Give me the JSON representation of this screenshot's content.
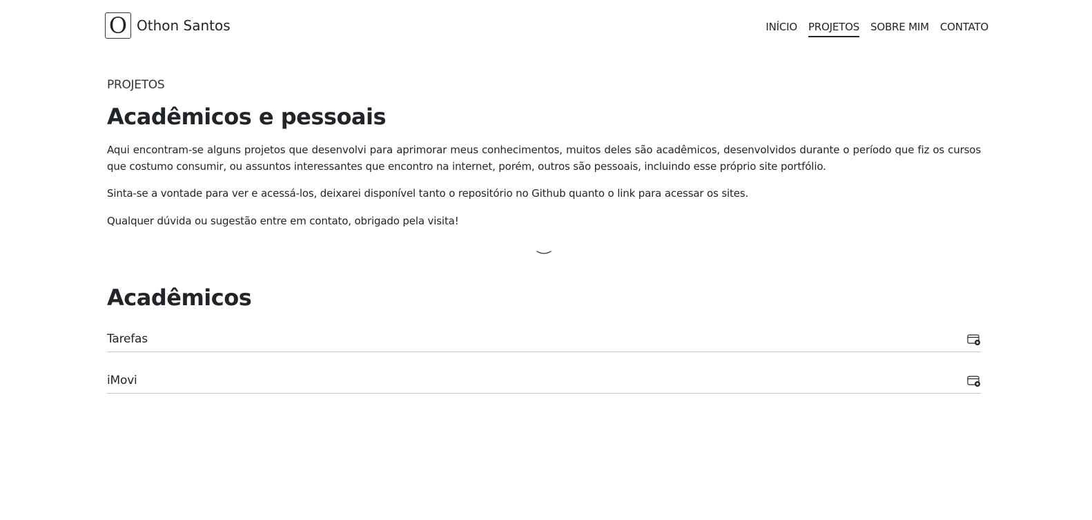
{
  "header": {
    "logo_letter": "O",
    "site_name": "Othon Santos",
    "nav": [
      {
        "label": "INÍCIO",
        "active": false
      },
      {
        "label": "PROJETOS",
        "active": true
      },
      {
        "label": "SOBRE MIM",
        "active": false
      },
      {
        "label": "CONTATO",
        "active": false
      }
    ]
  },
  "intro": {
    "eyebrow": "PROJETOS",
    "title": "Acadêmicos e pessoais",
    "paragraphs": [
      "Aqui encontram-se alguns projetos que desenvolvi para aprimorar meus conhecimentos, muitos deles são acadêmicos, desenvolvidos durante o período que fiz os cursos que costumo consumir, ou assuntos interessantes que encontro na internet, porém, outros são pessoais, incluindo esse próprio site portfólio.",
      "Sinta-se a vontade para ver e acessá-los, deixarei disponível tanto o repositório no Github quanto o link para acessar os sites.",
      "Qualquer dúvida ou sugestão entre em contato, obrigado pela visita!"
    ],
    "scroll_icon": "chevron-down-icon"
  },
  "academic": {
    "title": "Acadêmicos",
    "projects": [
      {
        "name": "Tarefas",
        "icon": "browser-add-icon"
      },
      {
        "name": "iMovi",
        "icon": "browser-add-icon"
      }
    ]
  },
  "colors": {
    "text": "#212529",
    "divider": "#c8c8c8",
    "background": "#ffffff"
  }
}
